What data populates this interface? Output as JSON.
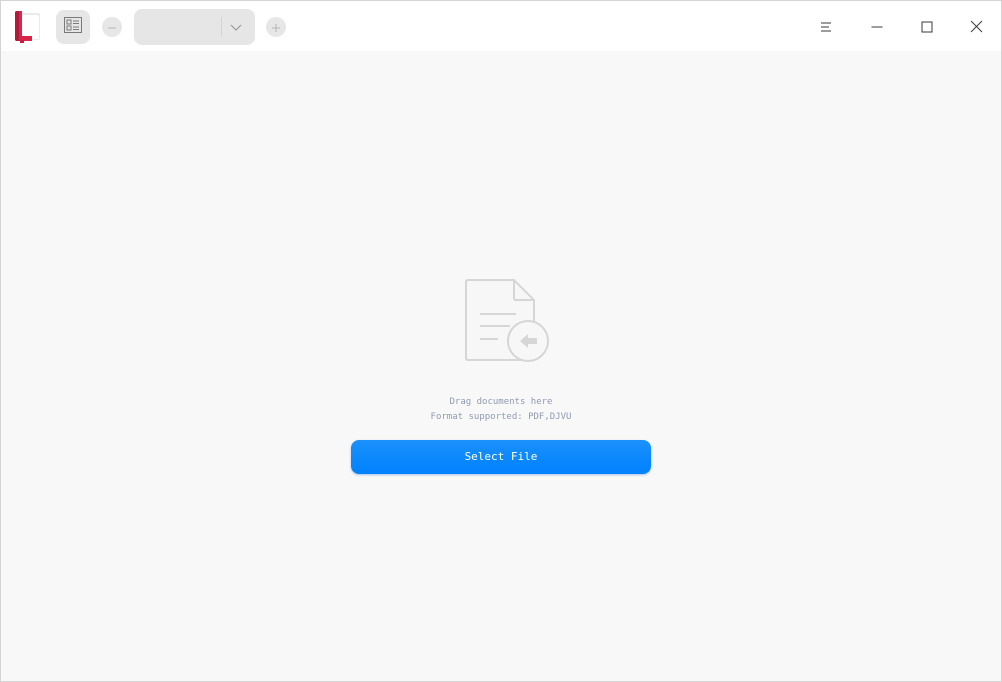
{
  "toolbar": {
    "zoom_value": "",
    "icons": {
      "app_logo": "document-viewer-logo",
      "sidebar_toggle": "thumbnail-sidebar-icon",
      "zoom_out": "minus-icon",
      "zoom_in": "plus-icon",
      "zoom_dropdown": "chevron-down-icon"
    }
  },
  "window_controls": {
    "icons": [
      "menu-icon",
      "minimize-icon",
      "maximize-icon",
      "close-icon"
    ]
  },
  "empty_state": {
    "drag_hint": "Drag documents here",
    "format_hint": "Format supported: PDF,DJVU",
    "select_button": "Select File",
    "illustration_icon": "document-import-icon"
  },
  "colors": {
    "accent": "#0081ff",
    "background": "#f8f8f8",
    "titlebar": "#ffffff",
    "hint_text": "#8f9bb0"
  }
}
